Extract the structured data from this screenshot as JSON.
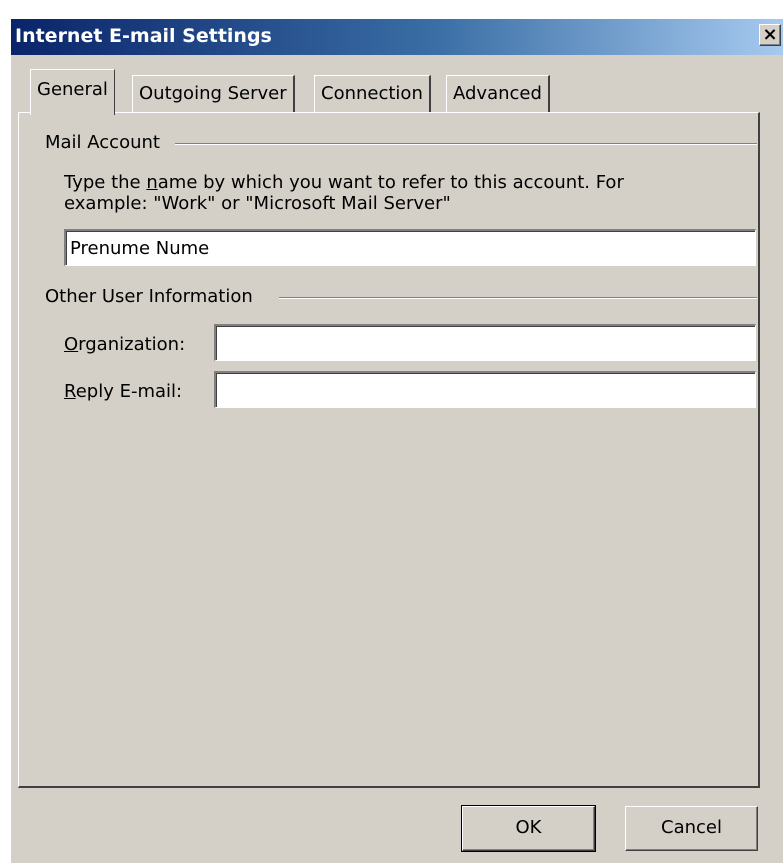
{
  "window": {
    "title": "Internet E-mail Settings",
    "close_label": "×"
  },
  "tabs": [
    {
      "label": "General",
      "active": true
    },
    {
      "label": "Outgoing Server",
      "active": false
    },
    {
      "label": "Connection",
      "active": false
    },
    {
      "label": "Advanced",
      "active": false
    }
  ],
  "mail_account": {
    "heading": "Mail Account",
    "desc_line1_pre": "Type the ",
    "desc_line1_u": "n",
    "desc_line1_post": "ame by which you want to refer to this account. For",
    "desc_line2": "example: \"Work\" or \"Microsoft Mail Server\"",
    "account_name_value": "Prenume Nume"
  },
  "other_info": {
    "heading": "Other User Information",
    "organization_u": "O",
    "organization_rest": "rganization:",
    "organization_value": "",
    "reply_u": "R",
    "reply_rest": "eply E-mail:",
    "reply_value": ""
  },
  "buttons": {
    "ok": "OK",
    "cancel": "Cancel"
  }
}
